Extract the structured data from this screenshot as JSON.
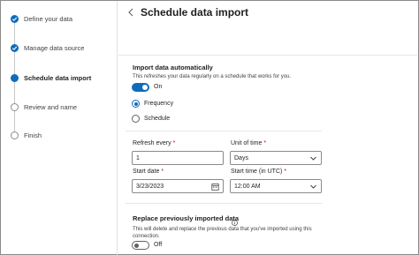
{
  "sidebar": {
    "steps": [
      {
        "label": "Define your data",
        "state": "done"
      },
      {
        "label": "Manage data source",
        "state": "done"
      },
      {
        "label": "Schedule data import",
        "state": "current"
      },
      {
        "label": "Review and name",
        "state": "pending"
      },
      {
        "label": "Finish",
        "state": "pending"
      }
    ]
  },
  "header": {
    "title": "Schedule data import",
    "back_icon": "chevron-left-icon"
  },
  "import_auto": {
    "title": "Import data automatically",
    "description": "This refreshes your data regularly on a schedule that works for you.",
    "toggle_label": "On",
    "toggle_on": true
  },
  "schedule_mode": {
    "options": [
      "Frequency",
      "Schedule"
    ],
    "selected": "Frequency"
  },
  "refresh_every": {
    "label": "Refresh every",
    "value": "1"
  },
  "unit_of_time": {
    "label": "Unit of time",
    "value": "Days"
  },
  "start_date": {
    "label": "Start date",
    "value": "3/23/2023"
  },
  "start_time": {
    "label": "Start time (in UTC)",
    "value": "12:00 AM"
  },
  "required_marker": "*",
  "replace": {
    "title": "Replace previously imported data",
    "description": "This will delete and replace the previous data that you've imported using this connection.",
    "toggle_label": "Off",
    "toggle_on": false
  },
  "colors": {
    "accent": "#0f6cbd",
    "required": "#b10e1c"
  }
}
